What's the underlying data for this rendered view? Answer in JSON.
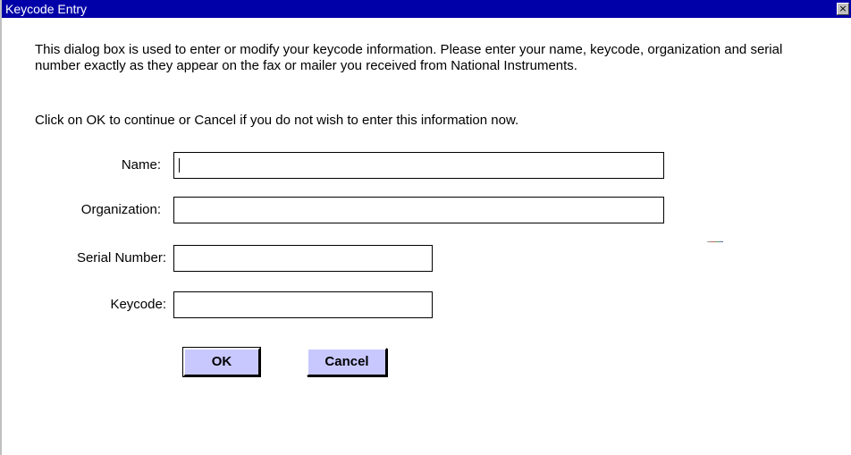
{
  "window": {
    "title": "Keycode Entry",
    "close_glyph": "×"
  },
  "dialog": {
    "intro_text": "This dialog box is used to enter or modify your keycode information.  Please enter your name, keycode, organization and serial number exactly as they appear on the fax or mailer you received from National Instruments.",
    "instruction_text": "Click on OK to continue or Cancel if you do not wish to enter this information now."
  },
  "fields": {
    "name": {
      "label": "Name:",
      "value": ""
    },
    "organization": {
      "label": "Organization:",
      "value": ""
    },
    "serial_number": {
      "label": "Serial Number:",
      "value": ""
    },
    "keycode": {
      "label": "Keycode:",
      "value": ""
    }
  },
  "buttons": {
    "ok_label": "OK",
    "cancel_label": "Cancel"
  },
  "colors": {
    "titlebar": "#0000a8",
    "button_face": "#c8c8ff"
  }
}
